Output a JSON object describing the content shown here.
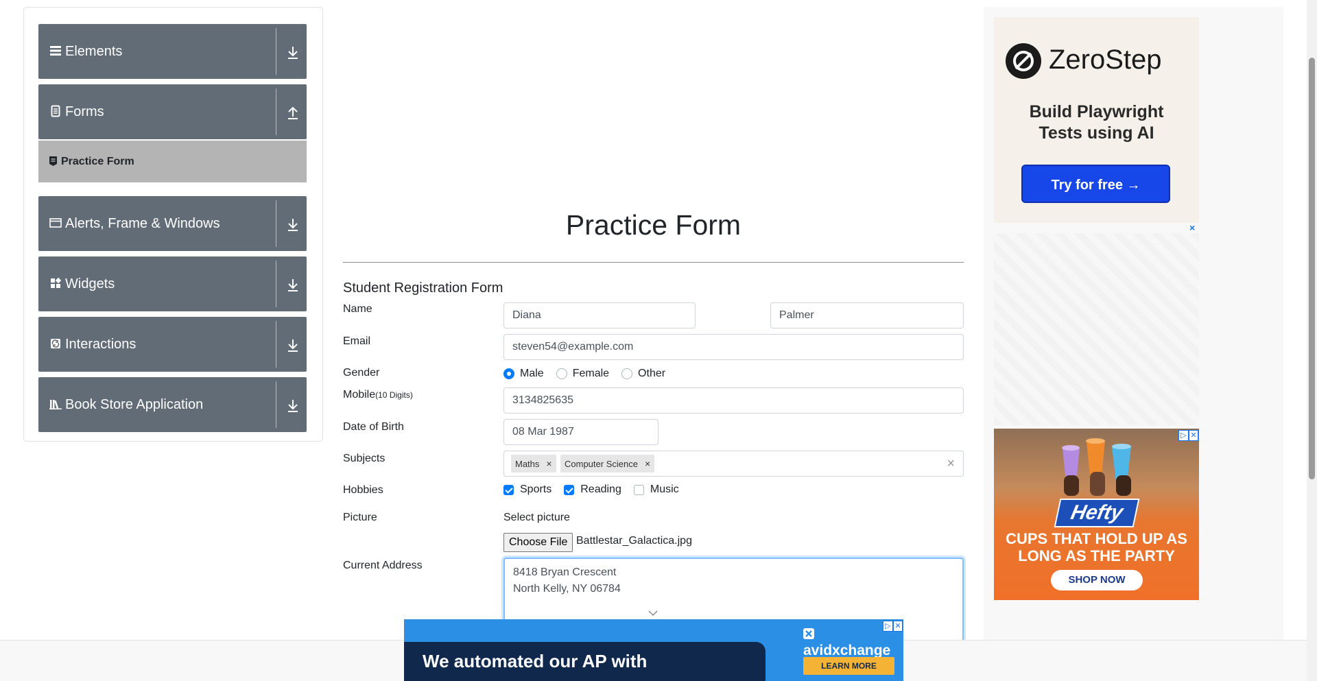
{
  "sidebar": {
    "groups": [
      {
        "label": "Elements",
        "icon": "hamburger-icon",
        "arrow": "download-arrow-icon"
      },
      {
        "label": "Forms",
        "icon": "document-icon",
        "arrow": "upload-arrow-icon"
      },
      {
        "label": "Alerts, Frame & Windows",
        "icon": "window-icon",
        "arrow": "download-arrow-icon"
      },
      {
        "label": "Widgets",
        "icon": "widgets-icon",
        "arrow": "download-arrow-icon"
      },
      {
        "label": "Interactions",
        "icon": "interactions-icon",
        "arrow": "download-arrow-icon"
      },
      {
        "label": "Book Store Application",
        "icon": "books-icon",
        "arrow": "download-arrow-icon"
      }
    ],
    "active_item": {
      "label": "Practice Form",
      "icon": "form-icon"
    }
  },
  "main": {
    "title": "Practice Form",
    "form_heading": "Student Registration Form",
    "labels": {
      "name": "Name",
      "email": "Email",
      "gender": "Gender",
      "mobile": "Mobile",
      "mobile_hint": "(10 Digits)",
      "dob": "Date of Birth",
      "subjects": "Subjects",
      "hobbies": "Hobbies",
      "picture": "Picture",
      "address": "Current Address"
    },
    "first_name": "Diana",
    "last_name": "Palmer",
    "email": "steven54@example.com",
    "gender_options": [
      {
        "label": "Male",
        "checked": true
      },
      {
        "label": "Female",
        "checked": false
      },
      {
        "label": "Other",
        "checked": false
      }
    ],
    "mobile": "3134825635",
    "dob": "08 Mar 1987",
    "subjects": [
      "Maths",
      "Computer Science"
    ],
    "subjects_clear": "×",
    "tag_remove": "×",
    "hobbies": [
      {
        "label": "Sports",
        "checked": true
      },
      {
        "label": "Reading",
        "checked": true
      },
      {
        "label": "Music",
        "checked": false
      }
    ],
    "select_picture": "Select picture",
    "choose_file": "Choose File",
    "file_name": "Battlestar_Galactica.jpg",
    "address_lines": [
      "8418 Bryan Crescent",
      "North Kelly, NY 06784"
    ]
  },
  "ads": {
    "zerostep": {
      "brand": "ZeroStep",
      "tagline_1": "Build Playwright",
      "tagline_2": "Tests using AI",
      "button": "Try for free →"
    },
    "close_x": "×",
    "hefty": {
      "brand": "Hefty",
      "text_1": "CUPS THAT HOLD UP AS",
      "text_2": "LONG AS THE PARTY",
      "button": "SHOP NOW",
      "adchoice": "▷",
      "close": "✕"
    },
    "avidxchange": {
      "headline": "We automated our AP with AvidXchange,",
      "brand": "avidxchange",
      "button": "LEARN MORE",
      "adchoice": "▷",
      "close": "✕"
    }
  },
  "colors": {
    "sidebar_group": "#626c76",
    "sidebar_active": "#b4b4b4",
    "accent": "#007bff",
    "zerostep_button": "#1747e8",
    "avid_blue": "#2b8fe6",
    "avid_navy": "#11284d"
  }
}
